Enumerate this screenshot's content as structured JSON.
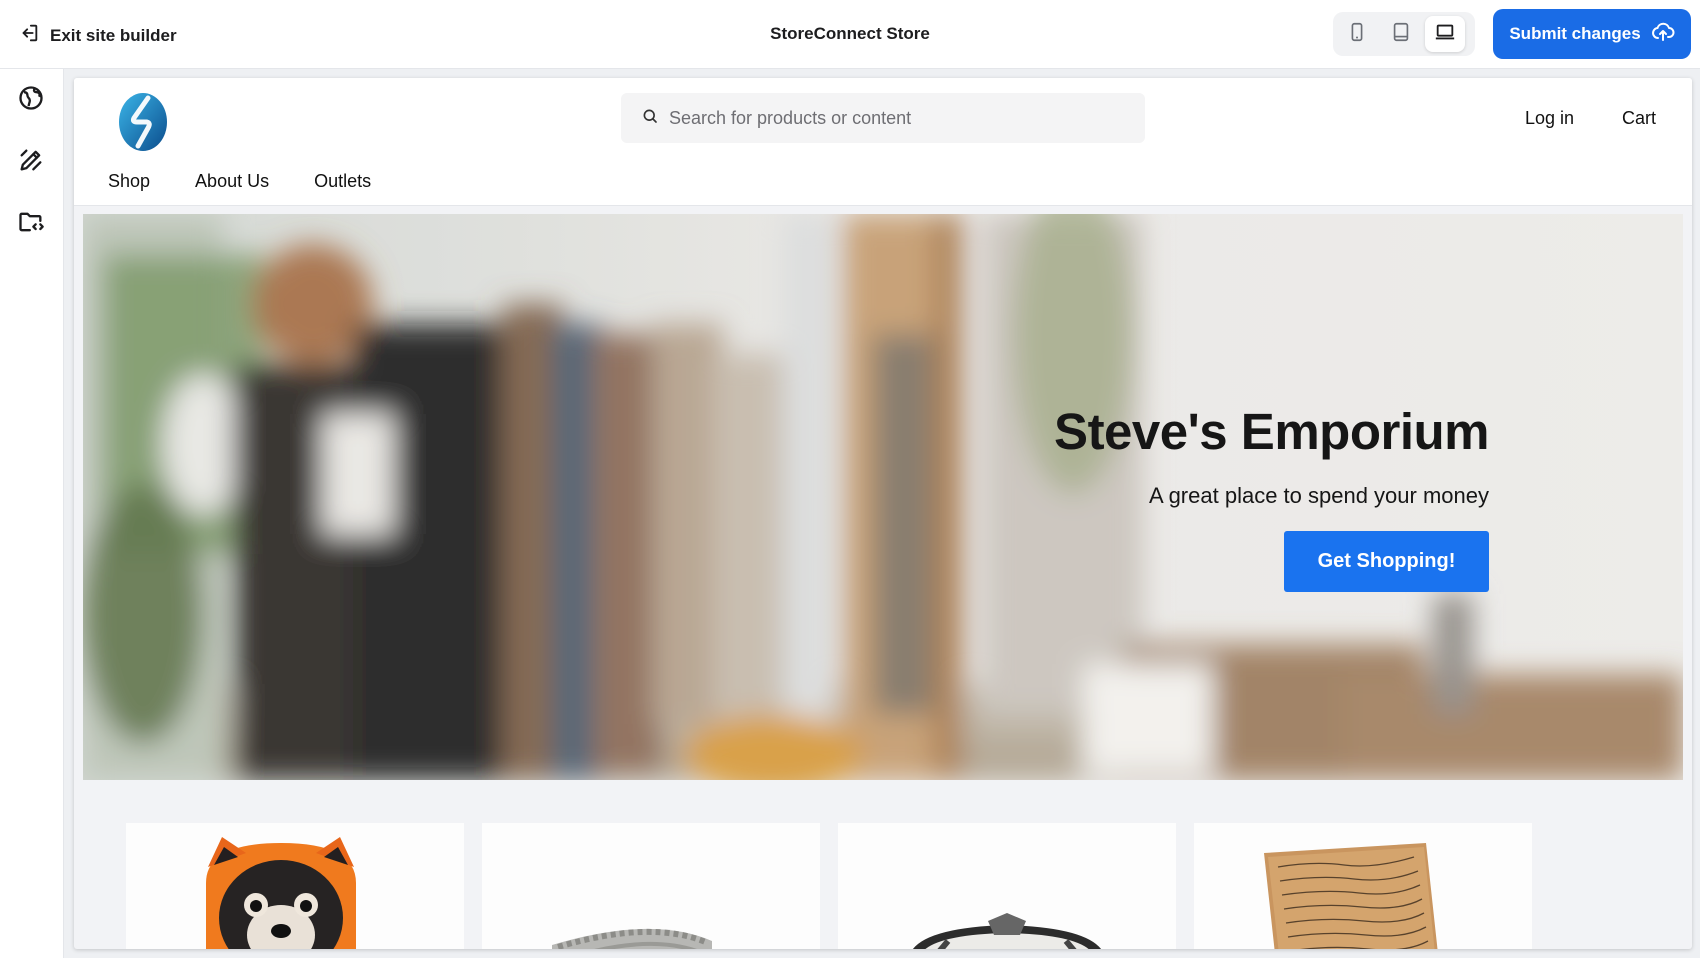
{
  "builder": {
    "exit_label": "Exit site builder",
    "store_title": "StoreConnect Store",
    "submit_label": "Submit changes",
    "devices": [
      "mobile",
      "tablet",
      "desktop"
    ],
    "active_device": "desktop",
    "accent_color": "#1a6ce6"
  },
  "rail": {
    "items": [
      "globe-icon",
      "design-pen-icon",
      "folder-code-icon"
    ]
  },
  "site": {
    "search_placeholder": "Search for products or content",
    "login_label": "Log in",
    "cart_label": "Cart",
    "nav": [
      "Shop",
      "About Us",
      "Outlets"
    ],
    "hero": {
      "title": "Steve's Emporium",
      "subtitle": "A great place to spend your money",
      "cta": "Get Shopping!",
      "cta_color": "#1a73ef"
    },
    "products": [
      {
        "image": "plush-raccoon-hood"
      },
      {
        "image": "silver-watch"
      },
      {
        "image": "steel-watch"
      },
      {
        "image": "handwritten-note"
      }
    ]
  }
}
